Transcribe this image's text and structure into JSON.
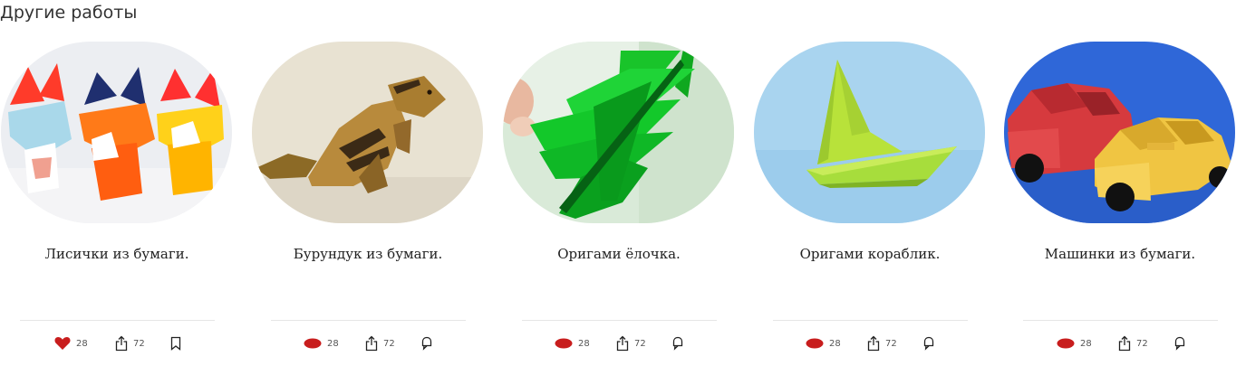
{
  "section": {
    "title": "Другие работы"
  },
  "cards": [
    {
      "title": "Лисички из бумаги.",
      "likes": "28",
      "shares": "72",
      "liked": true
    },
    {
      "title": "Бурундук из бумаги.",
      "likes": "28",
      "shares": "72",
      "liked": false
    },
    {
      "title": "Оригами ёлочка.",
      "likes": "28",
      "shares": "72",
      "liked": false
    },
    {
      "title": "Оригами кораблик.",
      "likes": "28",
      "shares": "72",
      "liked": false
    },
    {
      "title": "Машинки из бумаги.",
      "likes": "28",
      "shares": "72",
      "liked": false
    }
  ],
  "colors": {
    "like": "#c81d1d",
    "icon": "#222222",
    "divider": "#e6e6e6"
  },
  "icons": {
    "like": "heart-icon",
    "share": "share-icon",
    "bookmark": "bookmark-icon"
  }
}
